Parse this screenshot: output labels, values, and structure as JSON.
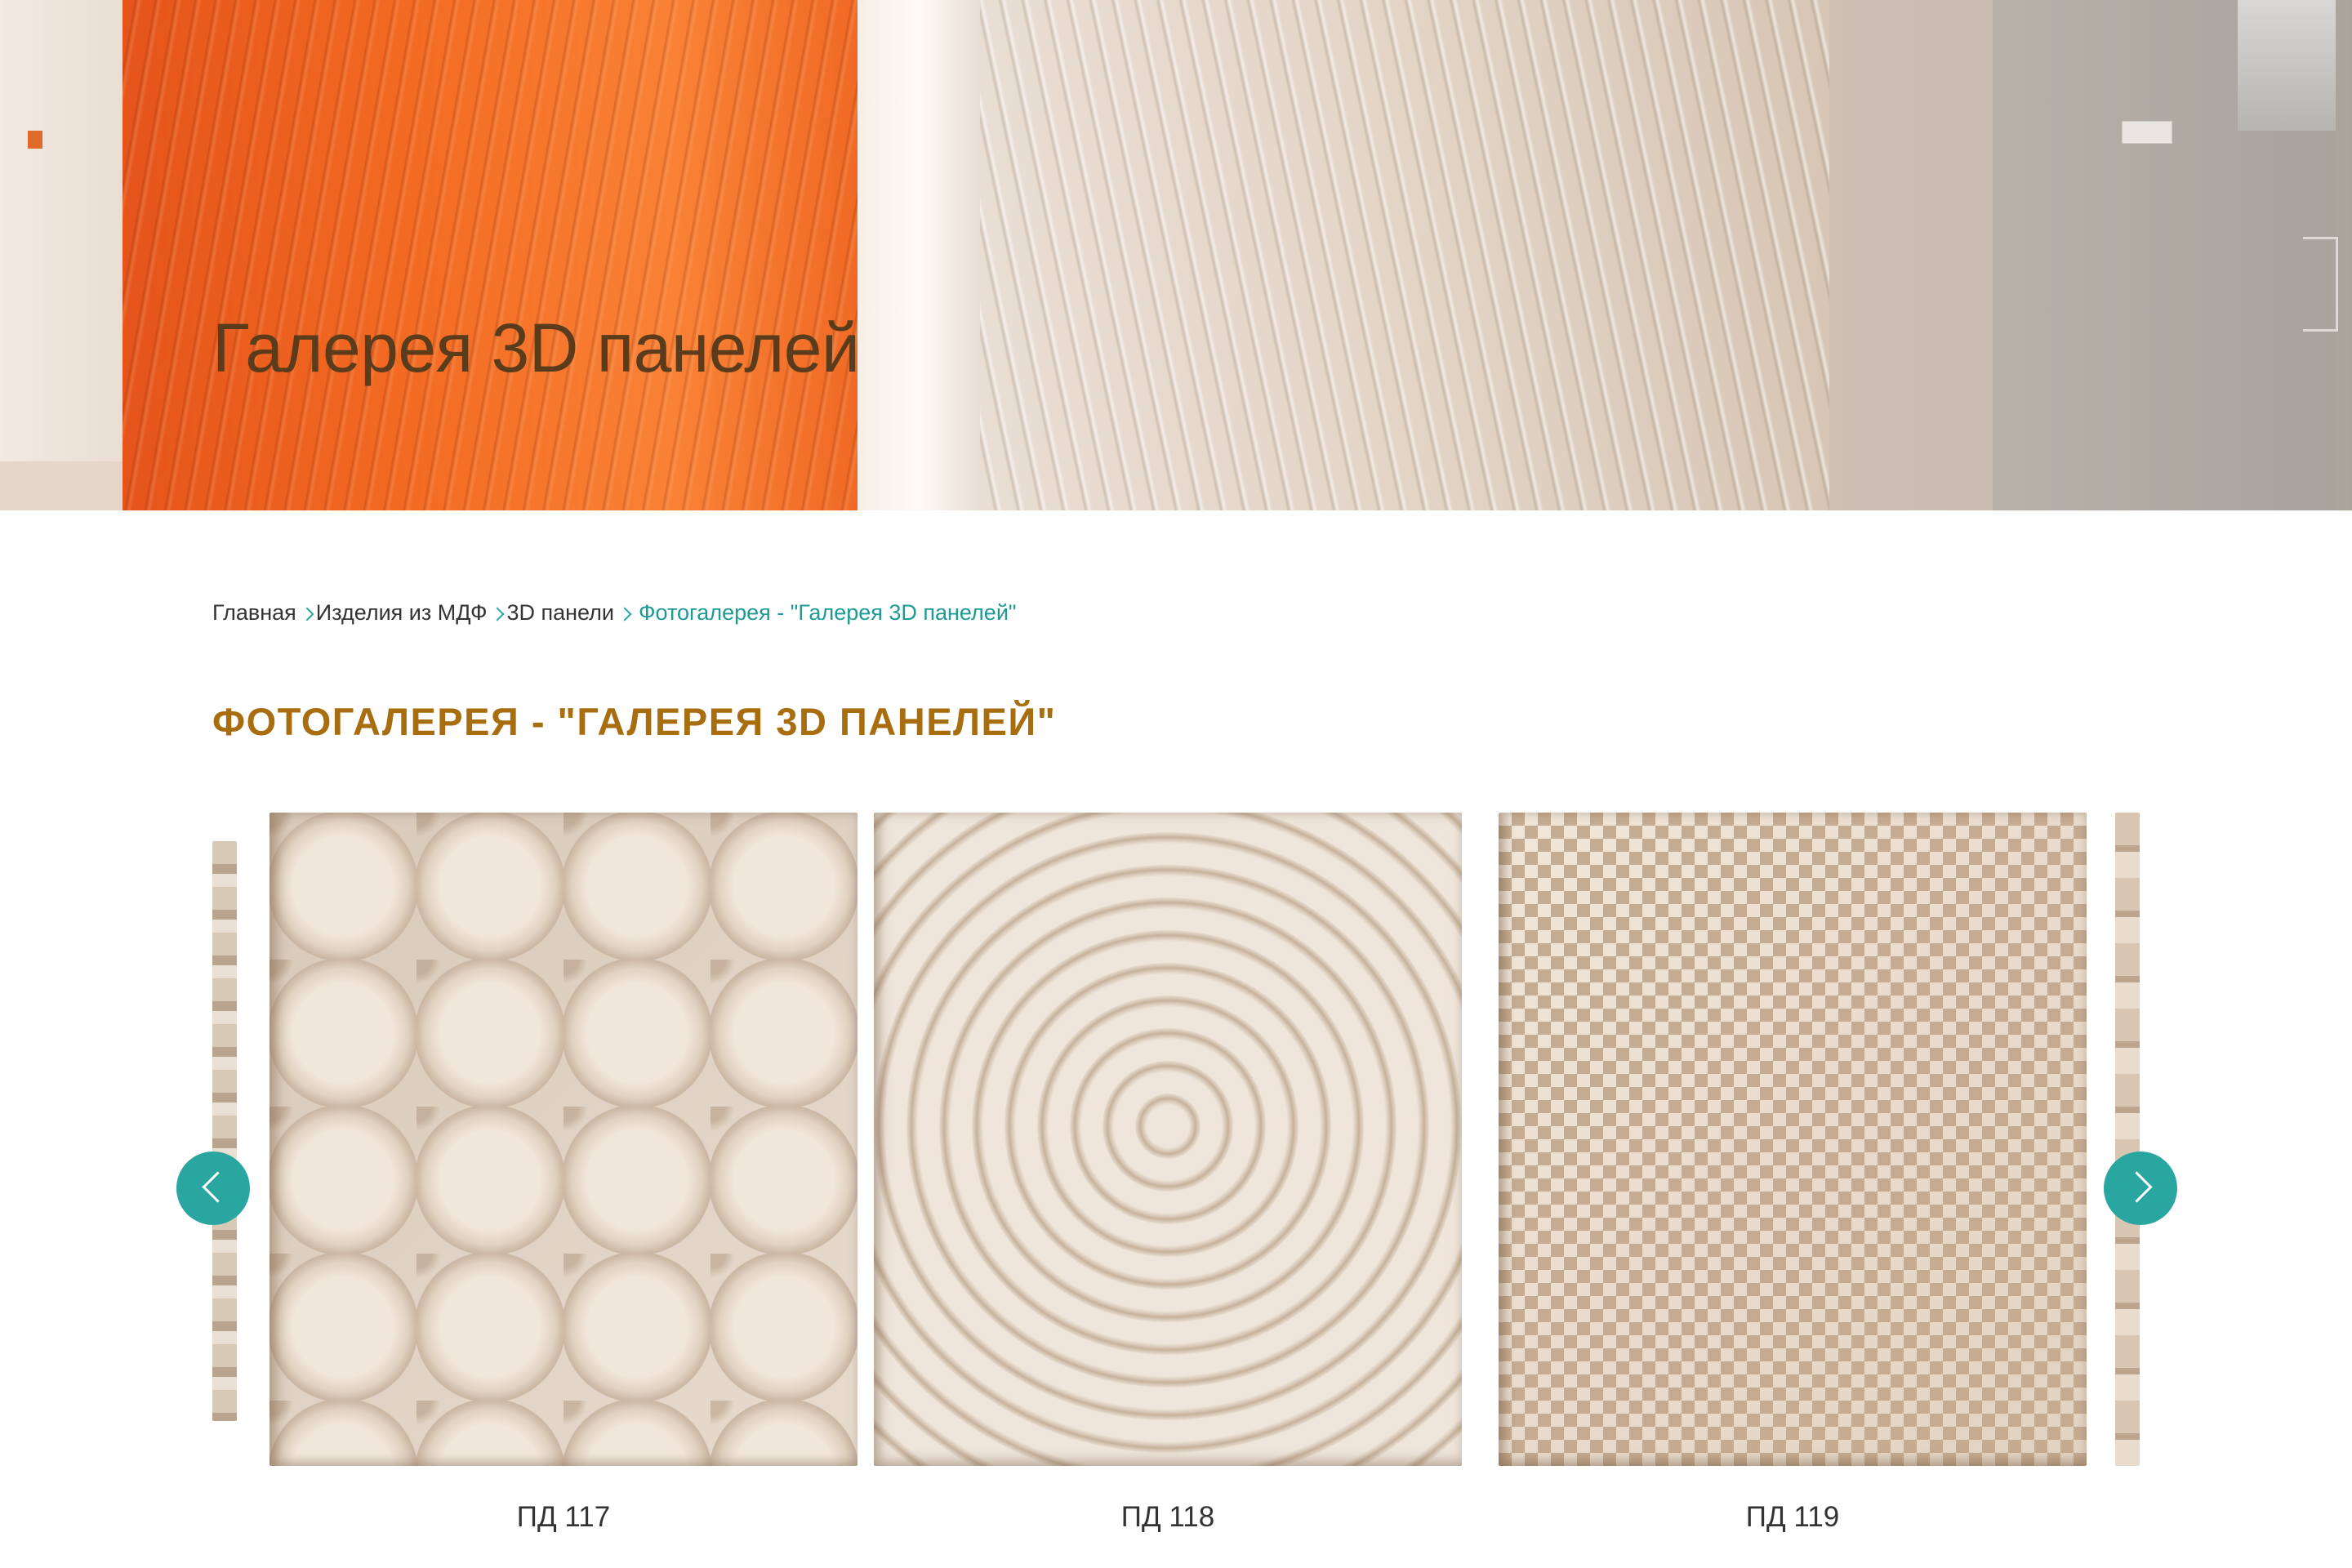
{
  "hero": {
    "title": "Галерея 3D панелей"
  },
  "breadcrumb": {
    "items": [
      {
        "label": "Главная"
      },
      {
        "label": "Изделия из МДФ"
      },
      {
        "label": "3D панели"
      }
    ],
    "current": "Фотогалерея - \"Галерея 3D панелей\""
  },
  "gallery": {
    "heading": "ФОТОГАЛЕРЕЯ - \"ГАЛЕРЕЯ 3D ПАНЕЛЕЙ\"",
    "items": [
      {
        "caption": "ПД 117"
      },
      {
        "caption": "ПД 118"
      },
      {
        "caption": "ПД 119"
      }
    ],
    "prev_icon": "chevron-left-icon",
    "next_icon": "chevron-right-icon"
  },
  "colors": {
    "accent": "#2aa6a0",
    "heading": "#a86d0e",
    "hero_title": "#5a3c1d"
  }
}
